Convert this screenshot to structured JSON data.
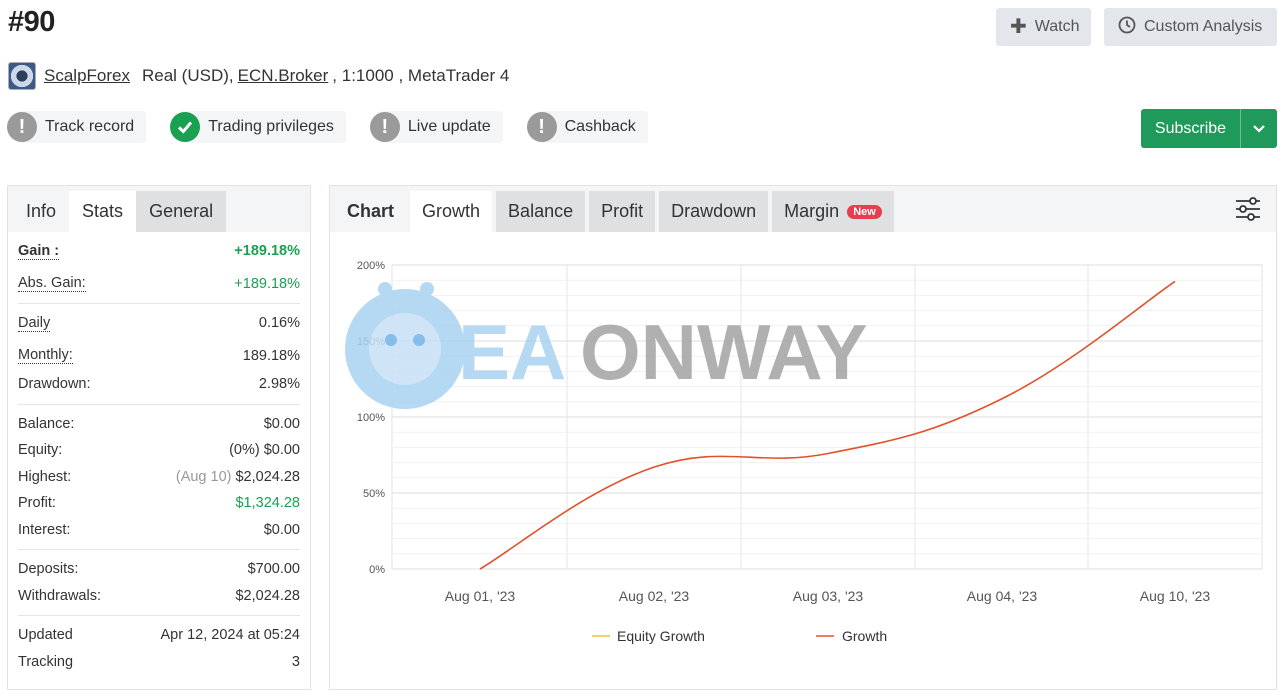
{
  "header": {
    "title": "#90",
    "watch_label": "Watch",
    "custom_analysis_label": "Custom Analysis"
  },
  "broker_line": {
    "broker": "ScalpForex",
    "account": "Real (USD),",
    "server": "ECN.Broker",
    "details": ", 1:1000 , MetaTrader 4"
  },
  "badges": [
    {
      "label": "Track record",
      "status": "warning"
    },
    {
      "label": "Trading privileges",
      "status": "ok"
    },
    {
      "label": "Live update",
      "status": "warning"
    },
    {
      "label": "Cashback",
      "status": "warning"
    }
  ],
  "subscribe_label": "Subscribe",
  "left_tabs": [
    "Info",
    "Stats",
    "General"
  ],
  "stats": {
    "gain": {
      "label": "Gain :",
      "value": "+189.18%"
    },
    "abs_gain": {
      "label": "Abs. Gain:",
      "value": "+189.18%"
    },
    "daily": {
      "label": "Daily",
      "value": "0.16%"
    },
    "monthly": {
      "label": "Monthly:",
      "value": "189.18%"
    },
    "drawdown": {
      "label": "Drawdown:",
      "value": "2.98%"
    },
    "balance": {
      "label": "Balance:",
      "value": "$0.00"
    },
    "equity": {
      "label": "Equity:",
      "prefix": "(0%)",
      "value": "$0.00"
    },
    "highest": {
      "label": "Highest:",
      "prefix": "(Aug 10)",
      "value": "$2,024.28"
    },
    "profit": {
      "label": "Profit:",
      "value": "$1,324.28"
    },
    "interest": {
      "label": "Interest:",
      "value": "$0.00"
    },
    "deposits": {
      "label": "Deposits:",
      "value": "$700.00"
    },
    "withdrawals": {
      "label": "Withdrawals:",
      "value": "$2,024.28"
    },
    "updated": {
      "label": "Updated",
      "value": "Apr 12, 2024 at 05:24"
    },
    "tracking": {
      "label": "Tracking",
      "value": "3"
    }
  },
  "chart_tabs": {
    "chart": "Chart",
    "growth": "Growth",
    "balance": "Balance",
    "profit": "Profit",
    "drawdown": "Drawdown",
    "margin": "Margin",
    "new_tag": "New"
  },
  "watermark": {
    "part1": "EA",
    "part2": "ONWAY"
  },
  "colors": {
    "growth_line": "#e0522a",
    "equity_line": "#f2c12e",
    "green": "#1aa050",
    "subscribe": "#1f9a5b"
  },
  "chart_data": {
    "type": "line",
    "categories": [
      "Aug 01, '23",
      "Aug 02, '23",
      "Aug 03, '23",
      "Aug 04, '23",
      "Aug 10, '23"
    ],
    "y_ticks": [
      "0%",
      "50%",
      "100%",
      "150%",
      "200%"
    ],
    "ylim": [
      0,
      200
    ],
    "grid": true,
    "legend": "bottom",
    "series": [
      {
        "name": "Equity Growth",
        "values": []
      },
      {
        "name": "Growth",
        "values": [
          0,
          67,
          76,
          112,
          189.18
        ]
      }
    ]
  }
}
